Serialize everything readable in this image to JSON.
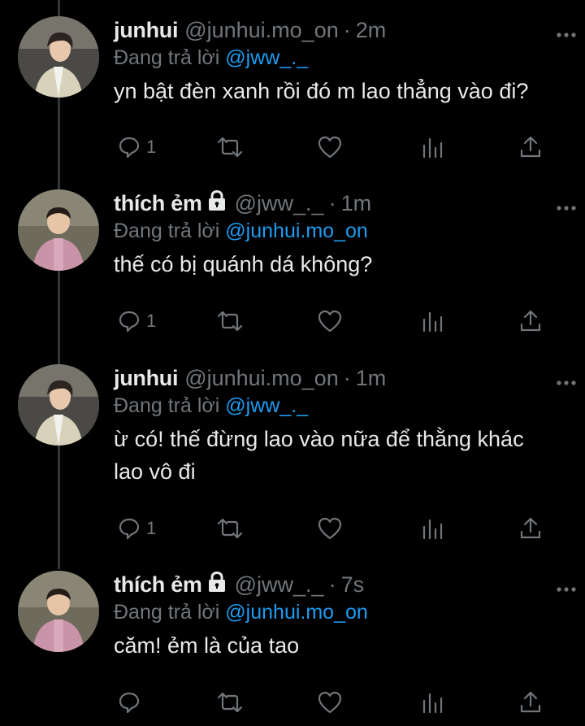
{
  "reply_prefix": "Đang trả lời",
  "colors": {
    "background": "#000000",
    "text": "#e7e9ea",
    "muted": "#71767b",
    "mention": "#1d9bf0",
    "thread_line": "#333639"
  },
  "tweets": [
    {
      "name": "junhui",
      "handle": "@junhui.mo_on",
      "separator": "·",
      "time": "2m",
      "replying_to": "@jww_._",
      "text": "yn bật đèn xanh rồi đó m lao thẳng vào đi?",
      "protected": false,
      "avatar": "man-in-cardigan-avatar",
      "actions": {
        "replies": "1",
        "retweets": "",
        "likes": ""
      }
    },
    {
      "name": "thích ẻm",
      "handle": "@jww_._",
      "separator": "·",
      "time": "1m",
      "replying_to": "@junhui.mo_on",
      "text": "thế có bị quánh dá không?",
      "protected": true,
      "avatar": "child-in-pink-jacket-avatar",
      "actions": {
        "replies": "1",
        "retweets": "",
        "likes": ""
      }
    },
    {
      "name": "junhui",
      "handle": "@junhui.mo_on",
      "separator": "·",
      "time": "1m",
      "replying_to": "@jww_._",
      "text": "ừ có! thế đừng lao vào nữa để thằng khác lao vô đi",
      "protected": false,
      "avatar": "man-in-cardigan-avatar",
      "actions": {
        "replies": "1",
        "retweets": "",
        "likes": ""
      }
    },
    {
      "name": "thích ẻm",
      "handle": "@jww_._",
      "separator": "·",
      "time": "7s",
      "replying_to": "@junhui.mo_on",
      "text": "căm! ẻm là của tao",
      "protected": true,
      "avatar": "child-in-pink-jacket-avatar",
      "actions": {
        "replies": "",
        "retweets": "",
        "likes": ""
      }
    }
  ]
}
